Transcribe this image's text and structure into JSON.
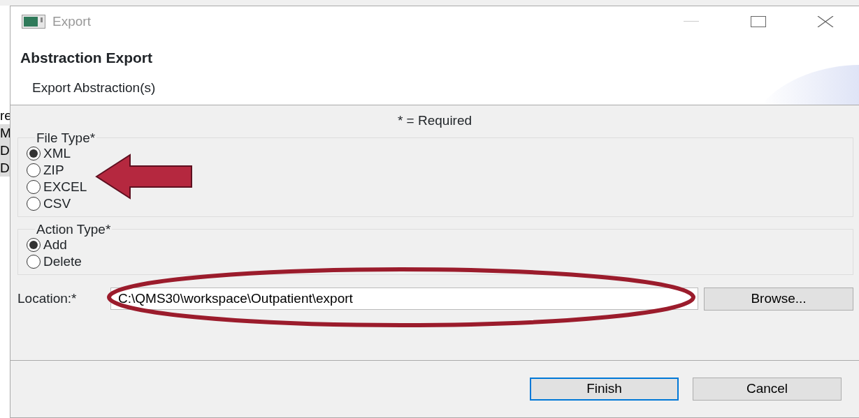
{
  "background_window": {
    "fragments": [
      "re",
      "M",
      "D",
      "D"
    ]
  },
  "window": {
    "title": "Export"
  },
  "header": {
    "title": "Abstraction Export",
    "subtitle": "Export Abstraction(s)"
  },
  "required_note": "* = Required",
  "groups": [
    {
      "label": "File Type*",
      "options": [
        {
          "label": "XML",
          "selected": true
        },
        {
          "label": "ZIP",
          "selected": false
        },
        {
          "label": "EXCEL",
          "selected": false
        },
        {
          "label": "CSV",
          "selected": false
        }
      ]
    },
    {
      "label": "Action Type*",
      "options": [
        {
          "label": "Add",
          "selected": true
        },
        {
          "label": "Delete",
          "selected": false
        }
      ]
    }
  ],
  "location": {
    "label": "Location:*",
    "value": "C:\\QMS30\\workspace\\Outpatient\\export",
    "button": "Browse..."
  },
  "buttons": [
    {
      "label": "Finish",
      "default": true
    },
    {
      "label": "Cancel",
      "default": false
    }
  ]
}
